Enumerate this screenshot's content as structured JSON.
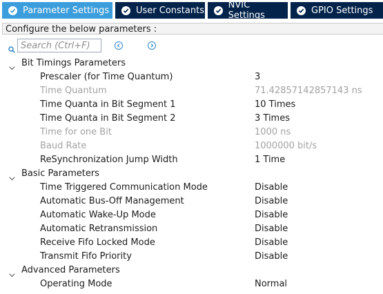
{
  "tabs": [
    {
      "label": "Parameter Settings",
      "active": true
    },
    {
      "label": "User Constants",
      "active": false
    },
    {
      "label": "NVIC Settings",
      "active": false
    },
    {
      "label": "GPIO Settings",
      "active": false
    }
  ],
  "header": {
    "text": "Configure the below parameters :"
  },
  "search": {
    "placeholder": "Search (Ctrl+F)"
  },
  "groups": [
    {
      "title": "Bit Timings Parameters",
      "params": [
        {
          "label": "Prescaler (for Time Quantum)",
          "value": "3",
          "enabled": true
        },
        {
          "label": "Time Quantum",
          "value": "71.42857142857143 ns",
          "enabled": false
        },
        {
          "label": "Time Quanta in Bit Segment 1",
          "value": "10 Times",
          "enabled": true
        },
        {
          "label": "Time Quanta in Bit Segment 2",
          "value": "3 Times",
          "enabled": true
        },
        {
          "label": "Time for one Bit",
          "value": "1000 ns",
          "enabled": false
        },
        {
          "label": "Baud Rate",
          "value": "1000000 bit/s",
          "enabled": false
        },
        {
          "label": "ReSynchronization Jump Width",
          "value": "1 Time",
          "enabled": true
        }
      ]
    },
    {
      "title": "Basic Parameters",
      "params": [
        {
          "label": "Time Triggered Communication Mode",
          "value": "Disable",
          "enabled": true
        },
        {
          "label": "Automatic Bus-Off Management",
          "value": "Disable",
          "enabled": true
        },
        {
          "label": "Automatic Wake-Up Mode",
          "value": "Disable",
          "enabled": true
        },
        {
          "label": "Automatic Retransmission",
          "value": "Disable",
          "enabled": true
        },
        {
          "label": "Receive Fifo Locked Mode",
          "value": "Disable",
          "enabled": true
        },
        {
          "label": "Transmit Fifo Priority",
          "value": "Disable",
          "enabled": true
        }
      ]
    },
    {
      "title": "Advanced Parameters",
      "params": [
        {
          "label": "Operating Mode",
          "value": "Normal",
          "enabled": true
        }
      ]
    }
  ],
  "colors": {
    "tab_active": "#3b9ddc",
    "tab_inactive": "#03234b",
    "disabled_text": "#a2a2a2"
  }
}
